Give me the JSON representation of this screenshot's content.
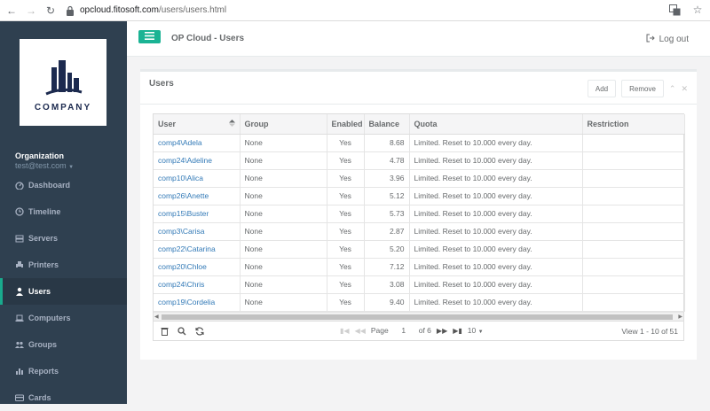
{
  "browser": {
    "url_host": "opcloud.fitosoft.com",
    "url_path": "/users/users.html"
  },
  "sidebar": {
    "logo_text": "COMPANY",
    "org_label": "Organization",
    "org_email": "test@test.com",
    "items": [
      {
        "label": "Dashboard",
        "icon": "dashboard-icon"
      },
      {
        "label": "Timeline",
        "icon": "clock-icon"
      },
      {
        "label": "Servers",
        "icon": "server-icon"
      },
      {
        "label": "Printers",
        "icon": "printer-icon"
      },
      {
        "label": "Users",
        "icon": "user-icon",
        "active": true
      },
      {
        "label": "Computers",
        "icon": "laptop-icon"
      },
      {
        "label": "Groups",
        "icon": "group-icon"
      },
      {
        "label": "Reports",
        "icon": "bar-chart-icon"
      },
      {
        "label": "Cards",
        "icon": "card-icon"
      }
    ]
  },
  "topbar": {
    "title": "OP Cloud - Users",
    "logout": "Log out"
  },
  "panel": {
    "title": "Users",
    "add": "Add",
    "remove": "Remove"
  },
  "grid": {
    "columns": [
      "User",
      "Group",
      "Enabled",
      "Balance",
      "Quota",
      "Restriction"
    ],
    "rows": [
      {
        "user": "comp4\\Adela",
        "group": "None",
        "enabled": "Yes",
        "balance": "8.68",
        "quota": "Limited. Reset to 10.000 every day.",
        "restriction": ""
      },
      {
        "user": "comp24\\Adeline",
        "group": "None",
        "enabled": "Yes",
        "balance": "4.78",
        "quota": "Limited. Reset to 10.000 every day.",
        "restriction": ""
      },
      {
        "user": "comp10\\Alica",
        "group": "None",
        "enabled": "Yes",
        "balance": "3.96",
        "quota": "Limited. Reset to 10.000 every day.",
        "restriction": ""
      },
      {
        "user": "comp26\\Anette",
        "group": "None",
        "enabled": "Yes",
        "balance": "5.12",
        "quota": "Limited. Reset to 10.000 every day.",
        "restriction": ""
      },
      {
        "user": "comp15\\Buster",
        "group": "None",
        "enabled": "Yes",
        "balance": "5.73",
        "quota": "Limited. Reset to 10.000 every day.",
        "restriction": ""
      },
      {
        "user": "comp3\\Carisa",
        "group": "None",
        "enabled": "Yes",
        "balance": "2.87",
        "quota": "Limited. Reset to 10.000 every day.",
        "restriction": ""
      },
      {
        "user": "comp22\\Catarina",
        "group": "None",
        "enabled": "Yes",
        "balance": "5.20",
        "quota": "Limited. Reset to 10.000 every day.",
        "restriction": ""
      },
      {
        "user": "comp20\\Chloe",
        "group": "None",
        "enabled": "Yes",
        "balance": "7.12",
        "quota": "Limited. Reset to 10.000 every day.",
        "restriction": ""
      },
      {
        "user": "comp24\\Chris",
        "group": "None",
        "enabled": "Yes",
        "balance": "3.08",
        "quota": "Limited. Reset to 10.000 every day.",
        "restriction": ""
      },
      {
        "user": "comp19\\Cordelia",
        "group": "None",
        "enabled": "Yes",
        "balance": "9.40",
        "quota": "Limited. Reset to 10.000 every day.",
        "restriction": ""
      }
    ]
  },
  "pager": {
    "page_label": "Page",
    "page_value": "1",
    "of_pages": "of 6",
    "rows_per_page": "10",
    "view_info": "View 1 - 10 of 51"
  }
}
